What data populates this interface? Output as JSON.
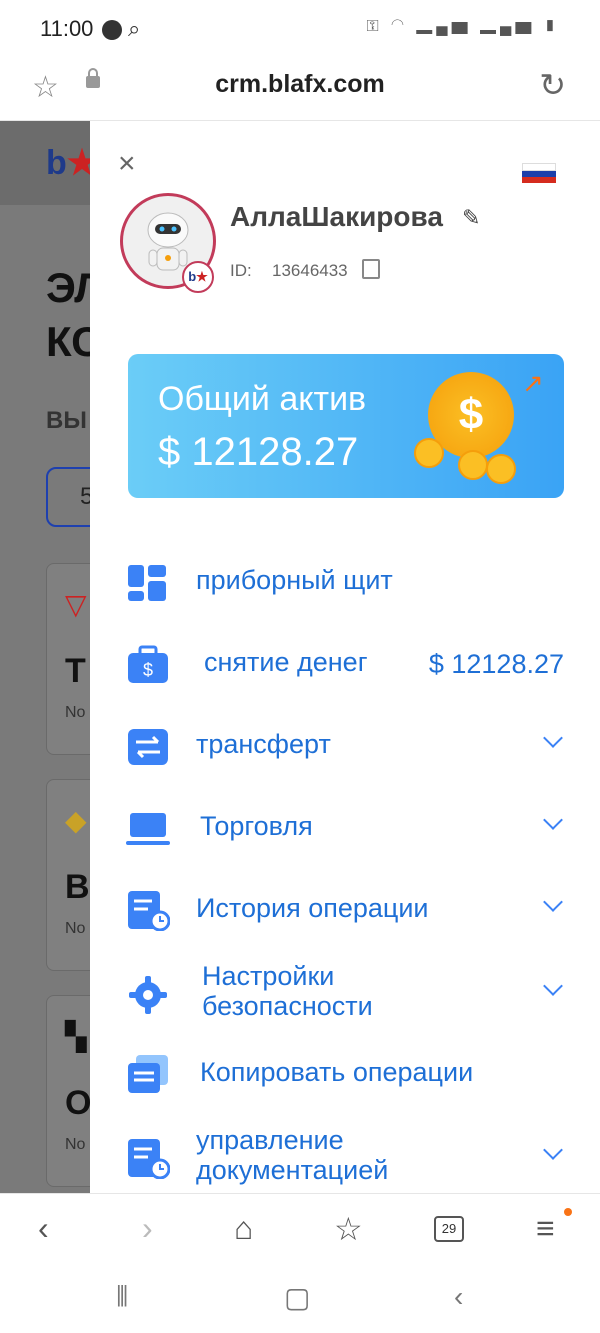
{
  "status_bar": {
    "time": "11:00"
  },
  "browser": {
    "url": "crm.blafx.com"
  },
  "background_page": {
    "logo": "b",
    "title_line1": "ЭЛ",
    "title_line2": "КС",
    "subtitle": "ВЫ",
    "input_value": "5",
    "cards": [
      {
        "label": "T",
        "sub": "No"
      },
      {
        "label": "B",
        "sub": "No"
      },
      {
        "label": "O",
        "sub": "No"
      }
    ]
  },
  "drawer": {
    "close_glyph": "×",
    "user": {
      "name": "АллаШакирова",
      "id_label": "ID:",
      "id_value": "13646433"
    },
    "asset": {
      "label": "Общий актив",
      "value": "$ 12128.27"
    },
    "menu": [
      {
        "label": "приборный щит",
        "icon": "dashboard-icon",
        "chevron": false
      },
      {
        "label": "снятие денег",
        "icon": "wallet-icon",
        "amount": "$ 12128.27",
        "chevron": false
      },
      {
        "label": "трансферт",
        "icon": "transfer-icon",
        "chevron": true
      },
      {
        "label": "Торговля",
        "icon": "laptop-icon",
        "chevron": true
      },
      {
        "label": "История операции",
        "icon": "history-icon",
        "chevron": true
      },
      {
        "label_line1": "Настройки",
        "label_line2": "безопасности",
        "icon": "gear-icon",
        "chevron": true
      },
      {
        "label": "Копировать операции",
        "icon": "copy-icon",
        "chevron": false
      },
      {
        "label_line1": "управление",
        "label_line2": "документацией",
        "icon": "document-icon",
        "chevron": true
      }
    ]
  },
  "browser_nav": {
    "tabs_count": "29"
  },
  "colors": {
    "accent": "#1e6fd6",
    "asset_gradient_start": "#6bcdf7",
    "asset_gradient_end": "#3aa3f5"
  }
}
